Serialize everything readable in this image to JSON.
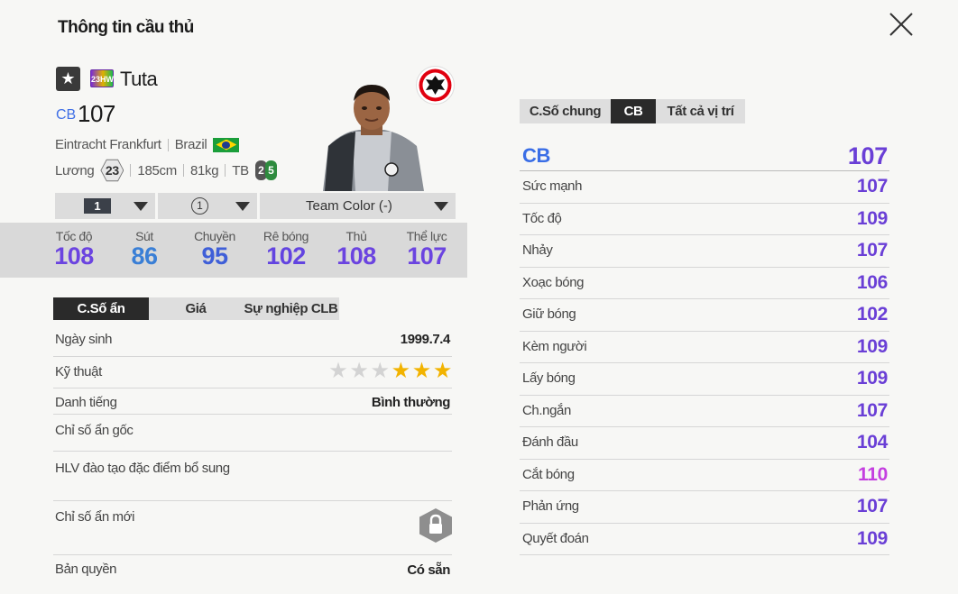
{
  "header": {
    "title": "Thông tin cầu thủ"
  },
  "player": {
    "star_icon": "star-icon",
    "season_badge": "23HW",
    "name": "Tuta",
    "position": "CB",
    "overall": "107",
    "club": "Eintracht Frankfurt",
    "nation": "Brazil",
    "salary_label": "Lương",
    "salary": "23",
    "height": "185cm",
    "weight": "81kg",
    "body_type": "TB",
    "weak_foot": "2",
    "strong_foot": "5"
  },
  "selectors": {
    "level": "1",
    "team_level": "1",
    "team_color": "Team Color (-)"
  },
  "summary_stats": [
    {
      "label": "Tốc độ",
      "value": "108",
      "color": "#6b44e0"
    },
    {
      "label": "Sút",
      "value": "86",
      "color": "#3a7fd6"
    },
    {
      "label": "Chuyền",
      "value": "95",
      "color": "#3f5fd8"
    },
    {
      "label": "Rê bóng",
      "value": "102",
      "color": "#6244e0"
    },
    {
      "label": "Thủ",
      "value": "108",
      "color": "#6b44e0"
    },
    {
      "label": "Thể lực",
      "value": "107",
      "color": "#6b44e0"
    }
  ],
  "left_tabs": [
    "C.Số ẩn",
    "Giá",
    "Sự nghiệp CLB"
  ],
  "details": {
    "birth_label": "Ngày sinh",
    "birth_value": "1999.7.4",
    "skill_label": "Kỹ thuật",
    "skill_stars": 3,
    "skill_max": 6,
    "rep_label": "Danh tiếng",
    "rep_value": "Bình thường",
    "orig_traits_label": "Chỉ số ẩn gốc",
    "coach_label": "HLV đào tạo đặc điểm bổ sung",
    "new_traits_label": "Chỉ số ẩn mới",
    "license_label": "Bản quyền",
    "license_value": "Có sẵn"
  },
  "right_tabs": [
    "C.Số chung",
    "CB",
    "Tất cả vị trí"
  ],
  "position_stats": {
    "position": "CB",
    "overall": "107",
    "rows": [
      {
        "label": "Sức mạnh",
        "value": "107",
        "color": "#6a3fd6"
      },
      {
        "label": "Tốc độ",
        "value": "109",
        "color": "#6a3fd6"
      },
      {
        "label": "Nhảy",
        "value": "107",
        "color": "#6a3fd6"
      },
      {
        "label": "Xoạc bóng",
        "value": "106",
        "color": "#6a3fd6"
      },
      {
        "label": "Giữ bóng",
        "value": "102",
        "color": "#6a3fd6"
      },
      {
        "label": "Kèm người",
        "value": "109",
        "color": "#6a3fd6"
      },
      {
        "label": "Lấy bóng",
        "value": "109",
        "color": "#6a3fd6"
      },
      {
        "label": "Ch.ngắn",
        "value": "107",
        "color": "#6a3fd6"
      },
      {
        "label": "Đánh đầu",
        "value": "104",
        "color": "#6a3fd6"
      },
      {
        "label": "Cắt bóng",
        "value": "110",
        "color": "#c43fe0"
      },
      {
        "label": "Phản ứng",
        "value": "107",
        "color": "#6a3fd6"
      },
      {
        "label": "Quyết đoán",
        "value": "109",
        "color": "#6a3fd6"
      }
    ]
  }
}
